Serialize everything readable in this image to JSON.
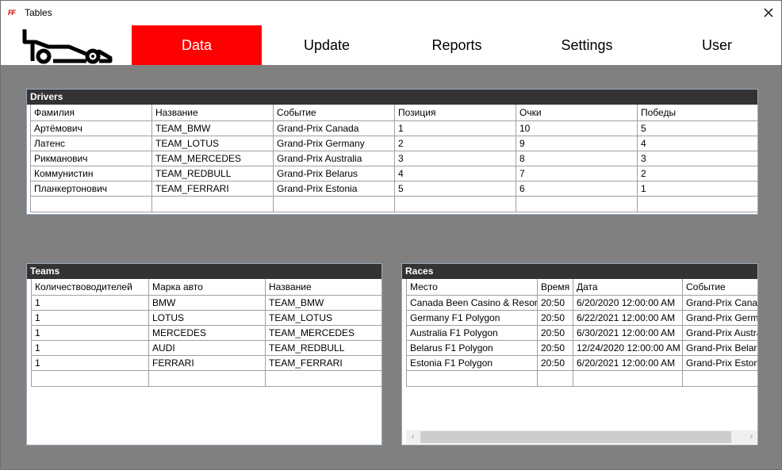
{
  "window": {
    "title": "Tables",
    "app_icon_glyph": "FF"
  },
  "nav": {
    "tabs": [
      {
        "label": "Data",
        "active": true
      },
      {
        "label": "Update",
        "active": false
      },
      {
        "label": "Reports",
        "active": false
      },
      {
        "label": "Settings",
        "active": false
      },
      {
        "label": "User",
        "active": false
      }
    ]
  },
  "drivers": {
    "title": "Drivers",
    "columns": [
      "Фамилия",
      "Название",
      "Событие",
      "Позиция",
      "Очки",
      "Победы"
    ],
    "rows": [
      [
        "Артёмович",
        "TEAM_BMW",
        "Grand-Prix Canada",
        "1",
        "10",
        "5"
      ],
      [
        "Латенс",
        "TEAM_LOTUS",
        "Grand-Prix Germany",
        "2",
        "9",
        "4"
      ],
      [
        "Рикманович",
        "TEAM_MERCEDES",
        "Grand-Prix Australia",
        "3",
        "8",
        "3"
      ],
      [
        "Коммунистин",
        "TEAM_REDBULL",
        "Grand-Prix Belarus",
        "4",
        "7",
        "2"
      ],
      [
        "Планкертонович",
        "TEAM_FERRARI",
        "Grand-Prix Estonia",
        "5",
        "6",
        "1"
      ]
    ]
  },
  "teams": {
    "title": "Teams",
    "columns": [
      "Количествоводителей",
      "Марка авто",
      "Название"
    ],
    "rows": [
      [
        "1",
        "BMW",
        "TEAM_BMW"
      ],
      [
        "1",
        "LOTUS",
        "TEAM_LOTUS"
      ],
      [
        "1",
        "MERCEDES",
        "TEAM_MERCEDES"
      ],
      [
        "1",
        "AUDI",
        "TEAM_REDBULL"
      ],
      [
        "1",
        "FERRARI",
        "TEAM_FERRARI"
      ]
    ]
  },
  "races": {
    "title": "Races",
    "columns": [
      "Место",
      "Время",
      "Дата",
      "Событие"
    ],
    "rows": [
      [
        "Canada Been Casino & Resort",
        "20:50",
        "6/20/2020 12:00:00 AM",
        "Grand-Prix Canada"
      ],
      [
        "Germany F1 Polygon",
        "20:50",
        "6/22/2021 12:00:00 AM",
        "Grand-Prix Germany"
      ],
      [
        "Australia F1 Polygon",
        "20:50",
        "6/30/2021 12:00:00 AM",
        "Grand-Prix Australia"
      ],
      [
        "Belarus F1 Polygon",
        "20:50",
        "12/24/2020 12:00:00 AM",
        "Grand-Prix Belarus"
      ],
      [
        "Estonia F1 Polygon",
        "20:50",
        "6/20/2021 12:00:00 AM",
        "Grand-Prix Estonia"
      ]
    ]
  },
  "icons": {
    "close": "close-icon",
    "logo": "race-car-logo-icon",
    "scroll_left": "chevron-left-icon",
    "scroll_right": "chevron-right-icon"
  },
  "colors": {
    "accent": "#ff0000",
    "header_bg": "#333333",
    "body_bg": "#808080"
  }
}
